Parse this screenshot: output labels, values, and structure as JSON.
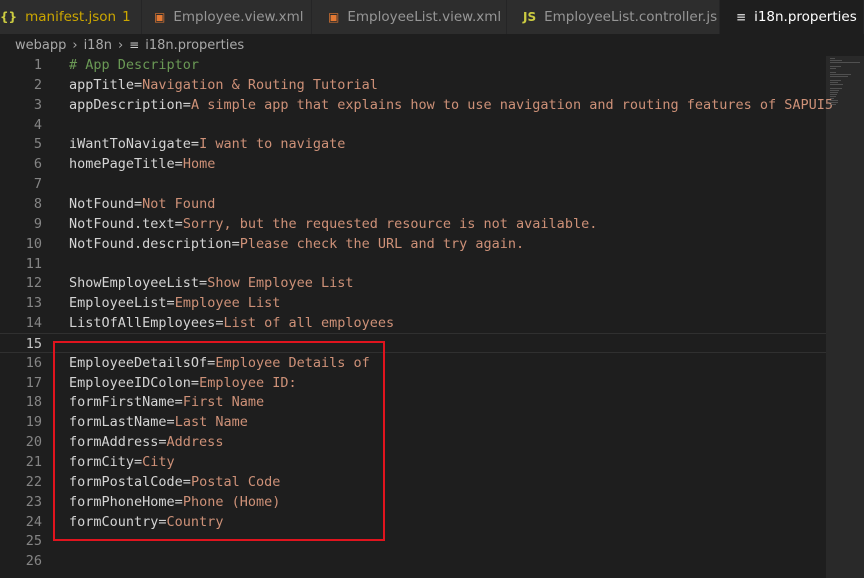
{
  "tabs": [
    {
      "icon": "{}",
      "label": "manifest.json",
      "badge": "1"
    },
    {
      "icon": "xml",
      "label": "Employee.view.xml"
    },
    {
      "icon": "xml",
      "label": "EmployeeList.view.xml"
    },
    {
      "icon": "JS",
      "label": "EmployeeList.controller.js"
    },
    {
      "icon": "≡",
      "label": "i18n.properties"
    }
  ],
  "breadcrumb": {
    "items": [
      "webapp",
      "i18n",
      "i18n.properties"
    ],
    "file_icon": "≡"
  },
  "editor": {
    "current_line": 15,
    "lines": [
      {
        "n": "1",
        "comment": "# App Descriptor"
      },
      {
        "n": "2",
        "key": "appTitle",
        "eq": "=",
        "value": "Navigation & Routing Tutorial"
      },
      {
        "n": "3",
        "key": "appDescription",
        "eq": "=",
        "value": "A simple app that explains how to use navigation and routing features of SAPUI5"
      },
      {
        "n": "4"
      },
      {
        "n": "5",
        "key": "iWantToNavigate",
        "eq": "=",
        "value": "I want to navigate"
      },
      {
        "n": "6",
        "key": "homePageTitle",
        "eq": "=",
        "value": "Home"
      },
      {
        "n": "7"
      },
      {
        "n": "8",
        "key": "NotFound",
        "eq": "=",
        "value": "Not Found"
      },
      {
        "n": "9",
        "key": "NotFound.text",
        "eq": "=",
        "value": "Sorry, but the requested resource is not available."
      },
      {
        "n": "10",
        "key": "NotFound.description",
        "eq": "=",
        "value": "Please check the URL and try again."
      },
      {
        "n": "11"
      },
      {
        "n": "12",
        "key": "ShowEmployeeList",
        "eq": "=",
        "value": "Show Employee List"
      },
      {
        "n": "13",
        "key": "EmployeeList",
        "eq": "=",
        "value": "Employee List"
      },
      {
        "n": "14",
        "key": "ListOfAllEmployees",
        "eq": "=",
        "value": "List of all employees"
      },
      {
        "n": "15"
      },
      {
        "n": "16",
        "key": "EmployeeDetailsOf",
        "eq": "=",
        "value": "Employee Details of"
      },
      {
        "n": "17",
        "key": "EmployeeIDColon",
        "eq": "=",
        "value": "Employee ID:"
      },
      {
        "n": "18",
        "key": "formFirstName",
        "eq": "=",
        "value": "First Name"
      },
      {
        "n": "19",
        "key": "formLastName",
        "eq": "=",
        "value": "Last Name"
      },
      {
        "n": "20",
        "key": "formAddress",
        "eq": "=",
        "value": "Address"
      },
      {
        "n": "21",
        "key": "formCity",
        "eq": "=",
        "value": "City"
      },
      {
        "n": "22",
        "key": "formPostalCode",
        "eq": "=",
        "value": "Postal Code"
      },
      {
        "n": "23",
        "key": "formPhoneHome",
        "eq": "=",
        "value": "Phone (Home)"
      },
      {
        "n": "24",
        "key": "formCountry",
        "eq": "=",
        "value": "Country"
      },
      {
        "n": "25"
      },
      {
        "n": "26"
      }
    ]
  },
  "colors": {
    "background": "#1e1e1e",
    "key": "#d4d4d4",
    "value": "#ce9178",
    "comment": "#6a9955",
    "line_number": "#858585",
    "highlight_box": "#e0141e",
    "warning_tab": "#cca700"
  }
}
